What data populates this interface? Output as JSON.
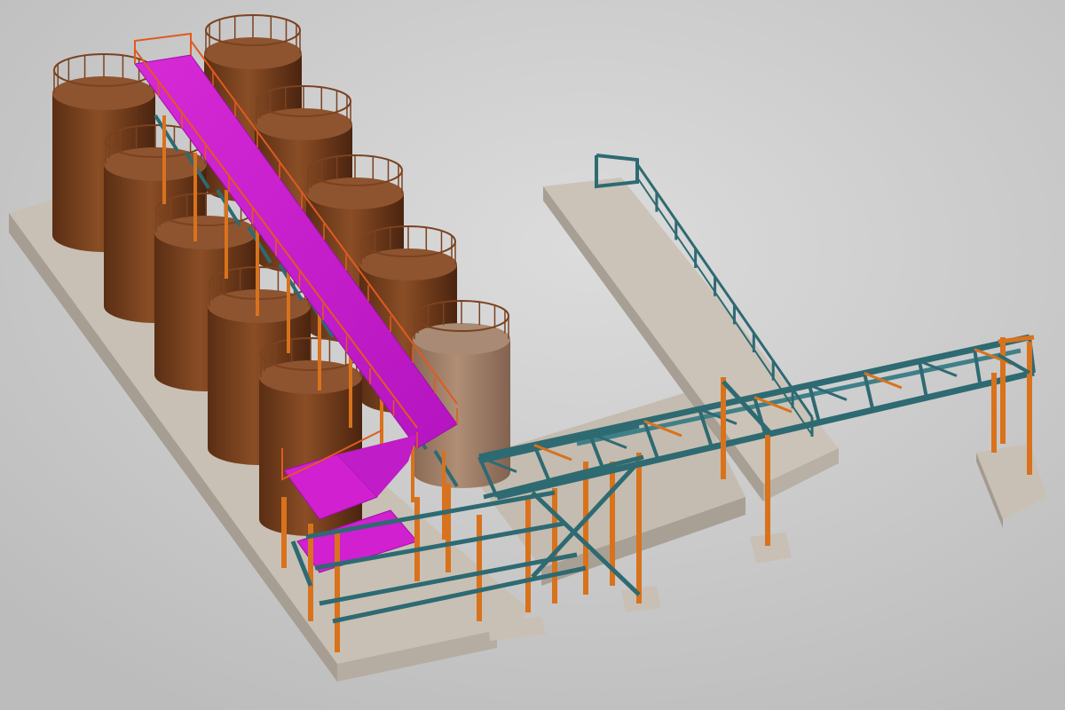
{
  "scene": {
    "kind": "3D model render",
    "colors": {
      "background_light": "#d9d9d9",
      "background_dark": "#bdbdbd",
      "concrete_top": "#c9c1b6",
      "concrete_side": "#a8a095",
      "tank_dark": "#5a2e14",
      "tank_mid": "#7a4220",
      "tank_highlight": "#8e5430",
      "tank_light_top": "#a98a74",
      "tank_light_body": "#9c7a62",
      "walkway": "#d020d0",
      "walkway_edge": "#a010a8",
      "railing": "#e05a20",
      "column_orange": "#d9721c",
      "beam_teal": "#2e6a72",
      "beam_teal_light": "#3f8088"
    },
    "tanks": {
      "back_row_count": 5,
      "front_row_count": 5
    }
  }
}
